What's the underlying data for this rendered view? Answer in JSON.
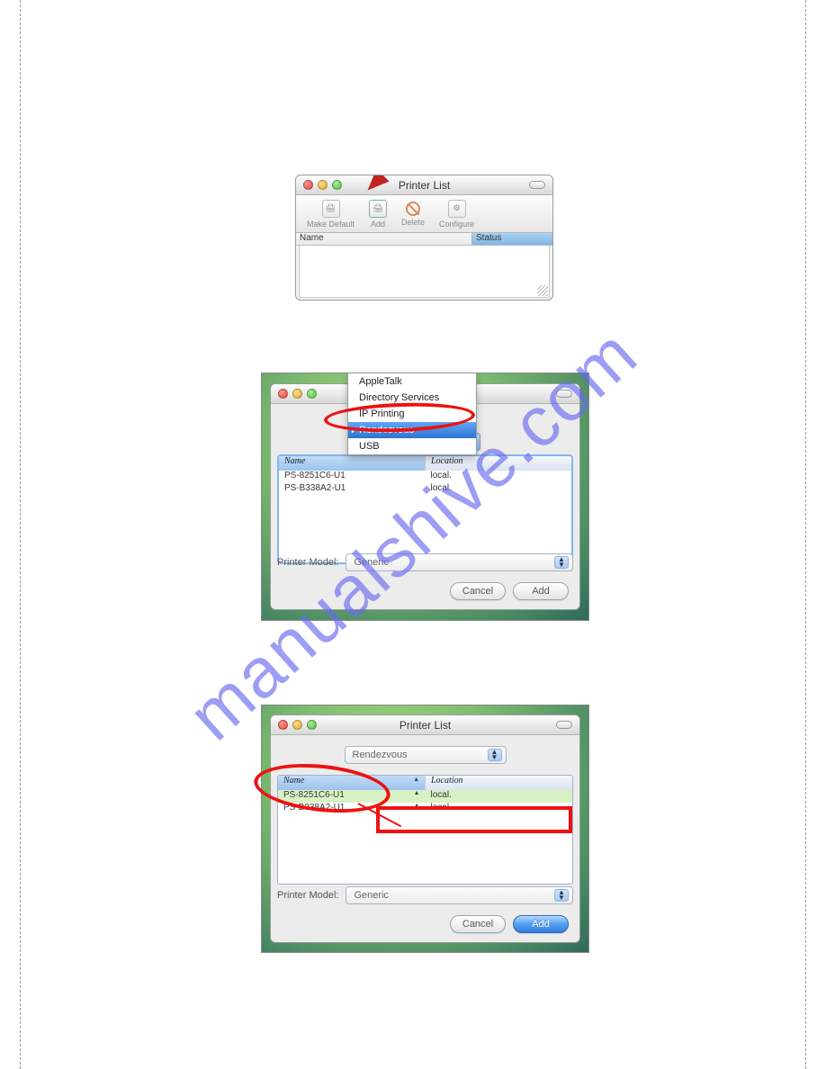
{
  "watermark": "manualshive.com",
  "s1": {
    "title": "Printer List",
    "toolbar": {
      "make_default": "Make Default",
      "add": "Add",
      "delete": "Delete",
      "configure": "Configure"
    },
    "headers": {
      "name": "Name",
      "status": "Status"
    }
  },
  "s2": {
    "dropdown_options": {
      "appletalk": "AppleTalk",
      "directory_services": "Directory Services",
      "ip_printing": "IP Printing",
      "rendezvous": "Rendezvous",
      "usb": "USB"
    },
    "list_headers": {
      "name": "Name",
      "location": "Location"
    },
    "rows": [
      {
        "name": "PS-8251C6-U1",
        "location": "local."
      },
      {
        "name": "PS-B338A2-U1",
        "location": "local."
      }
    ],
    "printer_model_label": "Printer Model:",
    "printer_model_value": "Generic",
    "cancel": "Cancel",
    "add": "Add"
  },
  "s3": {
    "title": "Printer List",
    "dropdown_value": "Rendezvous",
    "list_headers": {
      "name": "Name",
      "location": "Location"
    },
    "rows": [
      {
        "name": "PS-8251C6-U1",
        "location": "local."
      },
      {
        "name": "PS-B338A2-U1",
        "location": "local."
      }
    ],
    "printer_model_label": "Printer Model:",
    "printer_model_value": "Generic",
    "cancel": "Cancel",
    "add": "Add"
  }
}
